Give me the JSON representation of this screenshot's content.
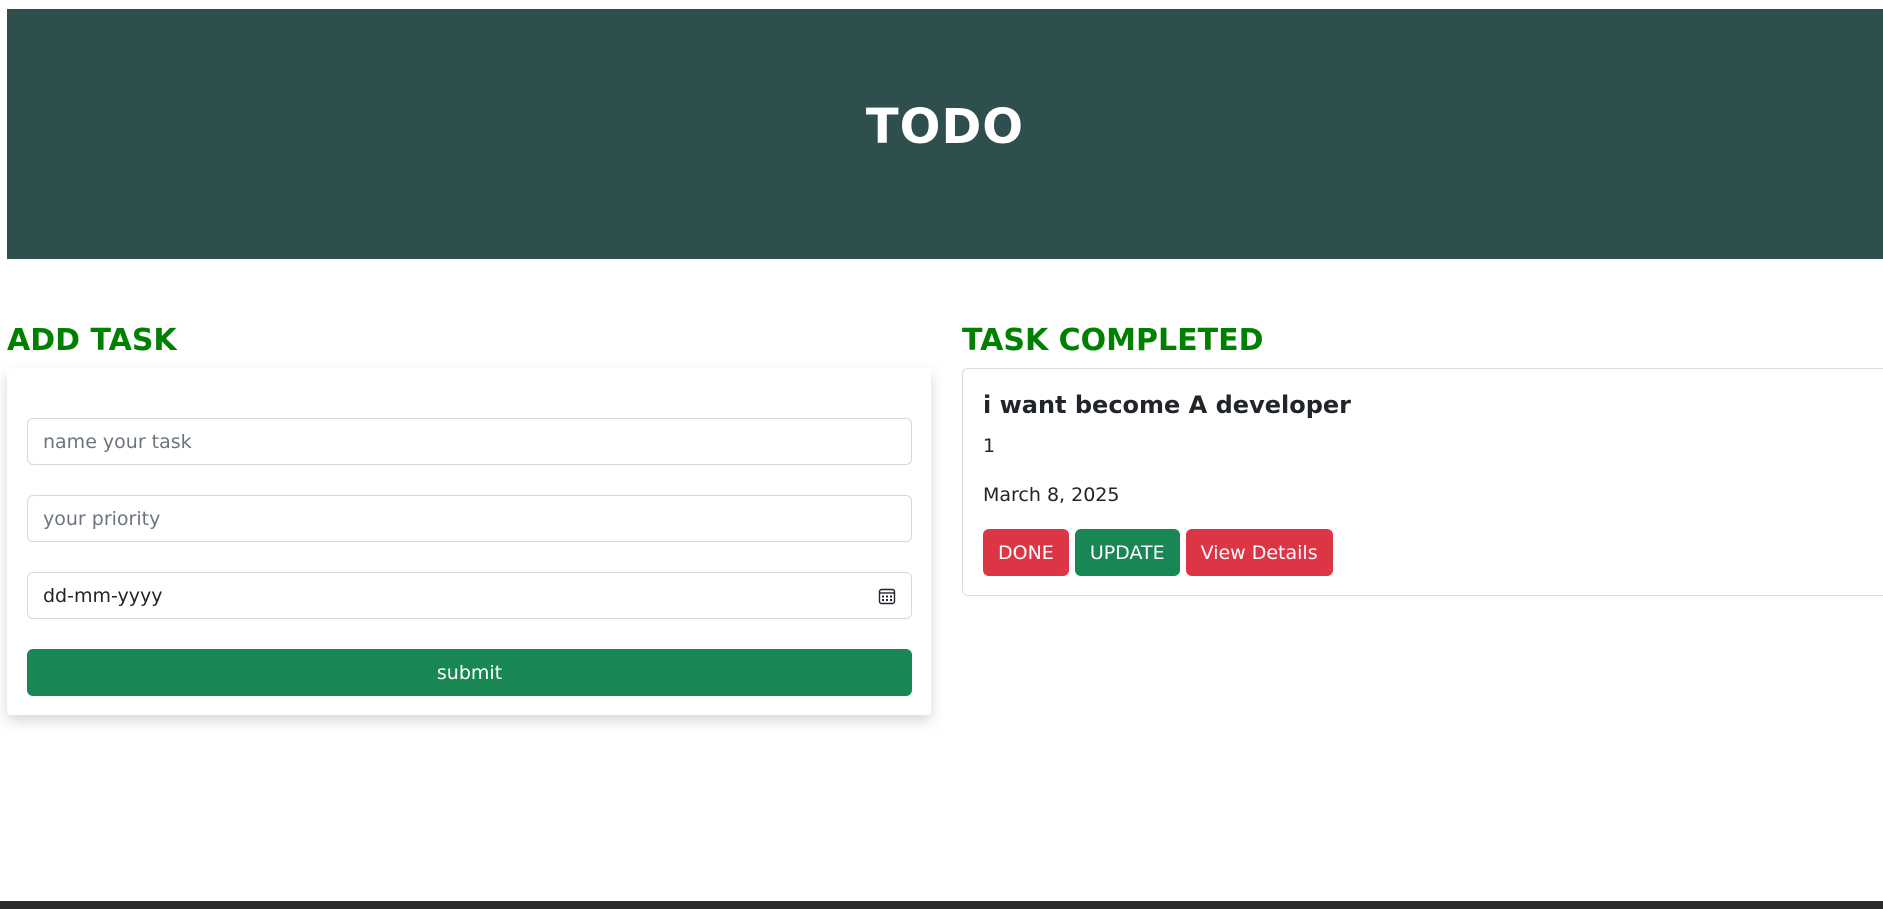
{
  "header": {
    "title": "TODO"
  },
  "add_task": {
    "heading": "ADD TASK",
    "name_placeholder": "name your task",
    "priority_placeholder": "your priority",
    "date_placeholder": "dd-mm-yyyy",
    "submit_label": "submit"
  },
  "completed": {
    "heading": "TASK COMPLETED",
    "tasks": [
      {
        "title": "i want become A developer",
        "priority": "1",
        "date": "March 8, 2025",
        "done_label": "DONE",
        "update_label": "UPDATE",
        "details_label": "View Details"
      }
    ]
  },
  "icons": {
    "date_picker": "calendar-icon"
  },
  "colors": {
    "header_bg": "#2f4f4f",
    "heading_green": "#008000",
    "success": "#198754",
    "danger": "#dc3545"
  }
}
